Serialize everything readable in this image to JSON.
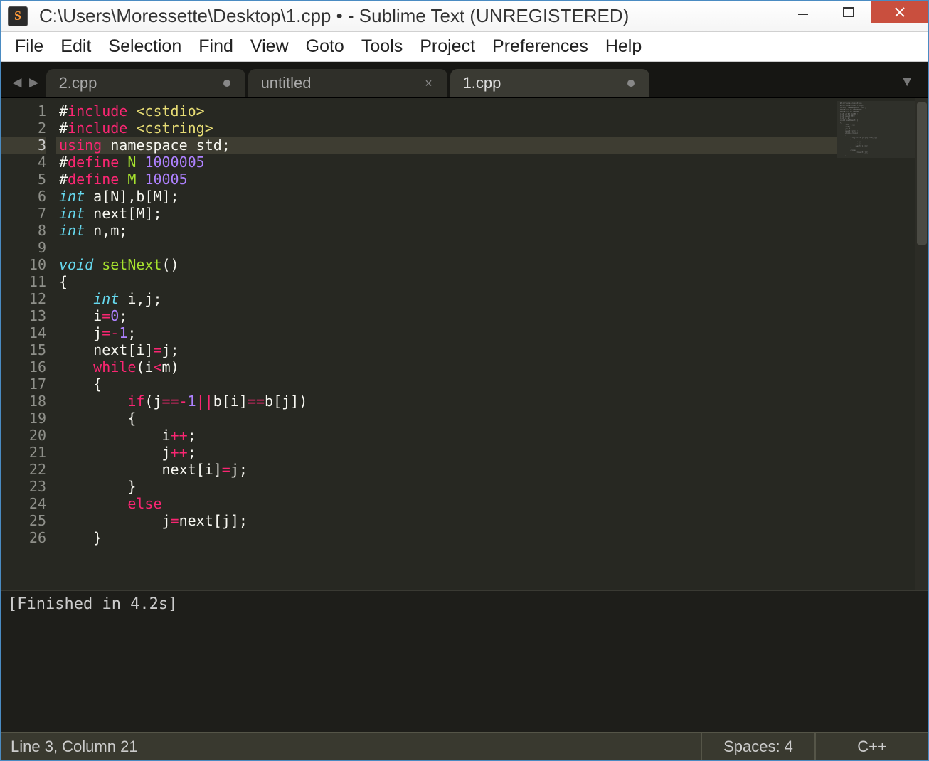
{
  "window": {
    "title": "C:\\Users\\Moressette\\Desktop\\1.cpp • - Sublime Text (UNREGISTERED)",
    "app_icon_letter": "S"
  },
  "menu": {
    "items": [
      "File",
      "Edit",
      "Selection",
      "Find",
      "View",
      "Goto",
      "Tools",
      "Project",
      "Preferences",
      "Help"
    ]
  },
  "tabs": {
    "items": [
      {
        "label": "2.cpp",
        "dirty": true,
        "active": false,
        "closable": false
      },
      {
        "label": "untitled",
        "dirty": false,
        "active": false,
        "closable": true
      },
      {
        "label": "1.cpp",
        "dirty": true,
        "active": true,
        "closable": false
      }
    ]
  },
  "editor": {
    "active_line": 3,
    "lines": [
      {
        "n": 1,
        "tokens": [
          [
            "#",
            "tk-hash"
          ],
          [
            "include",
            "tk-kwr"
          ],
          [
            " ",
            ""
          ],
          [
            "<cstdio>",
            "tk-inc"
          ]
        ]
      },
      {
        "n": 2,
        "tokens": [
          [
            "#",
            "tk-hash"
          ],
          [
            "include",
            "tk-kwr"
          ],
          [
            " ",
            ""
          ],
          [
            "<cstring>",
            "tk-inc"
          ]
        ]
      },
      {
        "n": 3,
        "tokens": [
          [
            "using",
            "tk-kwr"
          ],
          [
            " namespace std;",
            ""
          ]
        ]
      },
      {
        "n": 4,
        "tokens": [
          [
            "#",
            "tk-hash"
          ],
          [
            "define",
            "tk-kwr"
          ],
          [
            " ",
            ""
          ],
          [
            "N",
            "tk-fn"
          ],
          [
            " ",
            ""
          ],
          [
            "1000005",
            "tk-num"
          ]
        ]
      },
      {
        "n": 5,
        "tokens": [
          [
            "#",
            "tk-hash"
          ],
          [
            "define",
            "tk-kwr"
          ],
          [
            " ",
            ""
          ],
          [
            "M",
            "tk-fn"
          ],
          [
            " ",
            ""
          ],
          [
            "10005",
            "tk-num"
          ]
        ]
      },
      {
        "n": 6,
        "tokens": [
          [
            "int",
            "tk-type"
          ],
          [
            " a[N],b[M];",
            ""
          ]
        ]
      },
      {
        "n": 7,
        "tokens": [
          [
            "int",
            "tk-type"
          ],
          [
            " next[M];",
            ""
          ]
        ]
      },
      {
        "n": 8,
        "tokens": [
          [
            "int",
            "tk-type"
          ],
          [
            " n,m;",
            ""
          ]
        ]
      },
      {
        "n": 9,
        "tokens": [
          [
            "",
            ""
          ]
        ]
      },
      {
        "n": 10,
        "tokens": [
          [
            "void",
            "tk-type"
          ],
          [
            " ",
            ""
          ],
          [
            "setNext",
            "tk-fn"
          ],
          [
            "()",
            ""
          ]
        ]
      },
      {
        "n": 11,
        "tokens": [
          [
            "{",
            ""
          ]
        ]
      },
      {
        "n": 12,
        "tokens": [
          [
            "    ",
            ""
          ],
          [
            "int",
            "tk-type"
          ],
          [
            " i,j;",
            ""
          ]
        ]
      },
      {
        "n": 13,
        "tokens": [
          [
            "    i",
            ""
          ],
          [
            "=",
            "tk-op"
          ],
          [
            "0",
            "tk-num"
          ],
          [
            ";",
            ""
          ]
        ]
      },
      {
        "n": 14,
        "tokens": [
          [
            "    j",
            ""
          ],
          [
            "=-",
            "tk-op"
          ],
          [
            "1",
            "tk-num"
          ],
          [
            ";",
            ""
          ]
        ]
      },
      {
        "n": 15,
        "tokens": [
          [
            "    next[i]",
            ""
          ],
          [
            "=",
            "tk-op"
          ],
          [
            "j;",
            ""
          ]
        ]
      },
      {
        "n": 16,
        "tokens": [
          [
            "    ",
            ""
          ],
          [
            "while",
            "tk-kwr"
          ],
          [
            "(i",
            ""
          ],
          [
            "<",
            "tk-op"
          ],
          [
            "m)",
            ""
          ]
        ]
      },
      {
        "n": 17,
        "tokens": [
          [
            "    {",
            ""
          ]
        ]
      },
      {
        "n": 18,
        "tokens": [
          [
            "        ",
            ""
          ],
          [
            "if",
            "tk-kwr"
          ],
          [
            "(j",
            ""
          ],
          [
            "==-",
            "tk-op"
          ],
          [
            "1",
            "tk-num"
          ],
          [
            "||",
            "tk-op"
          ],
          [
            "b[i]",
            ""
          ],
          [
            "==",
            "tk-op"
          ],
          [
            "b[j])",
            ""
          ]
        ]
      },
      {
        "n": 19,
        "tokens": [
          [
            "        {",
            ""
          ]
        ]
      },
      {
        "n": 20,
        "tokens": [
          [
            "            i",
            ""
          ],
          [
            "++",
            "tk-op"
          ],
          [
            ";",
            ""
          ]
        ]
      },
      {
        "n": 21,
        "tokens": [
          [
            "            j",
            ""
          ],
          [
            "++",
            "tk-op"
          ],
          [
            ";",
            ""
          ]
        ]
      },
      {
        "n": 22,
        "tokens": [
          [
            "            next[i]",
            ""
          ],
          [
            "=",
            "tk-op"
          ],
          [
            "j;",
            ""
          ]
        ]
      },
      {
        "n": 23,
        "tokens": [
          [
            "        }",
            ""
          ]
        ]
      },
      {
        "n": 24,
        "tokens": [
          [
            "        ",
            ""
          ],
          [
            "else",
            "tk-kwr"
          ]
        ]
      },
      {
        "n": 25,
        "tokens": [
          [
            "            j",
            ""
          ],
          [
            "=",
            "tk-op"
          ],
          [
            "next[j];",
            ""
          ]
        ]
      },
      {
        "n": 26,
        "tokens": [
          [
            "    }",
            ""
          ]
        ]
      }
    ]
  },
  "output": {
    "text": "[Finished in 4.2s]"
  },
  "status": {
    "position": "Line 3, Column 21",
    "indent": "Spaces: 4",
    "syntax": "C++"
  }
}
